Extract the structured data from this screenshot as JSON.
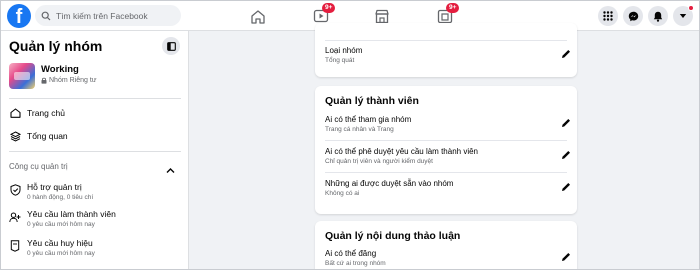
{
  "header": {
    "logo_letter": "f",
    "search_placeholder": "Tìm kiếm trên Facebook",
    "tabs": [
      {
        "icon": "home-icon"
      },
      {
        "icon": "watch-icon",
        "badge": "9+"
      },
      {
        "icon": "marketplace-icon"
      },
      {
        "icon": "gaming-icon",
        "badge": "9+"
      }
    ],
    "right_buttons": [
      "menu-grid-icon",
      "messenger-icon",
      "notifications-icon",
      "account-dropdown-icon"
    ],
    "colors": {
      "brand": "#1877f2",
      "badge": "#e41e3f"
    }
  },
  "sidebar": {
    "title": "Quản lý nhóm",
    "group_name": "Working",
    "group_privacy": "Nhóm Riêng tư",
    "nav": [
      {
        "label": "Trang chủ",
        "icon": "home-outline-icon"
      },
      {
        "label": "Tổng quan",
        "icon": "overview-icon"
      }
    ],
    "section_title": "Công cụ quản trị",
    "tools": [
      {
        "title": "Hỗ trợ quản trị",
        "sub": "0 hành động, 0 tiêu chí",
        "icon": "admin-assist-icon"
      },
      {
        "title": "Yêu cầu làm thành viên",
        "sub": "0 yêu cầu mới hôm nay",
        "icon": "member-request-icon"
      },
      {
        "title": "Yêu cầu huy hiệu",
        "sub": "0 yêu cầu mới hôm nay",
        "icon": "badge-request-icon"
      }
    ]
  },
  "main": {
    "top_card": {
      "row": {
        "label": "Loại nhóm",
        "sub": "Tổng quát"
      }
    },
    "membership_card": {
      "title": "Quản lý thành viên",
      "rows": [
        {
          "label": "Ai có thể tham gia nhóm",
          "sub": "Trang cá nhân và Trang"
        },
        {
          "label": "Ai có thể phê duyệt yêu cầu làm thành viên",
          "sub": "Chỉ quản trị viên và người kiểm duyệt"
        },
        {
          "label": "Những ai được duyệt sẵn vào nhóm",
          "sub": "Không có ai"
        }
      ]
    },
    "discussion_card": {
      "title": "Quản lý nội dung thảo luận",
      "rows": [
        {
          "label": "Ai có thể đăng",
          "sub": "Bất cứ ai trong nhóm"
        }
      ]
    }
  }
}
